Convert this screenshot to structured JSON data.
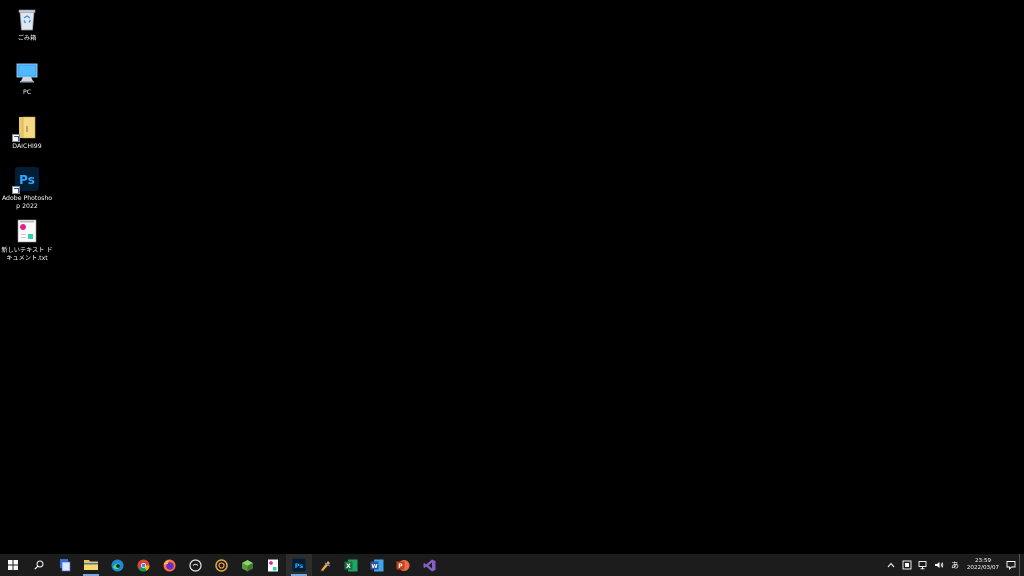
{
  "desktop": {
    "icons": [
      {
        "label": "ごみ箱",
        "icon": "recycle-bin-icon"
      },
      {
        "label": "PC",
        "icon": "pc-monitor-icon"
      },
      {
        "label": "DAICHI99",
        "icon": "folder-shortcut-icon"
      },
      {
        "label": "Adobe Photoshop 2022",
        "icon": "photoshop-shortcut-icon"
      },
      {
        "label": "新しいテキスト ドキュメント.txt",
        "icon": "text-document-icon"
      }
    ]
  },
  "taskbar": {
    "apps": [
      {
        "icon": "start-windows-icon"
      },
      {
        "icon": "search-icon"
      },
      {
        "icon": "app-generic-icon"
      },
      {
        "icon": "file-explorer-icon"
      },
      {
        "icon": "edge-browser-icon"
      },
      {
        "icon": "chrome-browser-icon"
      },
      {
        "icon": "firefox-browser-icon"
      },
      {
        "icon": "circle-app-icon"
      },
      {
        "icon": "ring-app-icon"
      },
      {
        "icon": "cube-app-icon"
      },
      {
        "icon": "document-app-icon"
      },
      {
        "icon": "photoshop-icon"
      },
      {
        "icon": "pen-tool-icon"
      },
      {
        "icon": "excel-icon"
      },
      {
        "icon": "word-icon"
      },
      {
        "icon": "powerpoint-icon"
      },
      {
        "icon": "visual-studio-icon"
      }
    ],
    "photoshop_label": "Ps",
    "excel_label": "X",
    "word_label": "W",
    "powerpoint_label": "P",
    "tray": {
      "ime_label": "あ",
      "time": "23:59",
      "date": "2022/03/07"
    }
  },
  "colors": {
    "taskbar_bg": "#1c1c1c",
    "active_underline": "#7aa9e0",
    "photoshop": "#31a8ff",
    "excel": "#1d6f42",
    "word": "#2b579a",
    "powerpoint": "#c43e1c",
    "visual_studio": "#865fc5"
  }
}
